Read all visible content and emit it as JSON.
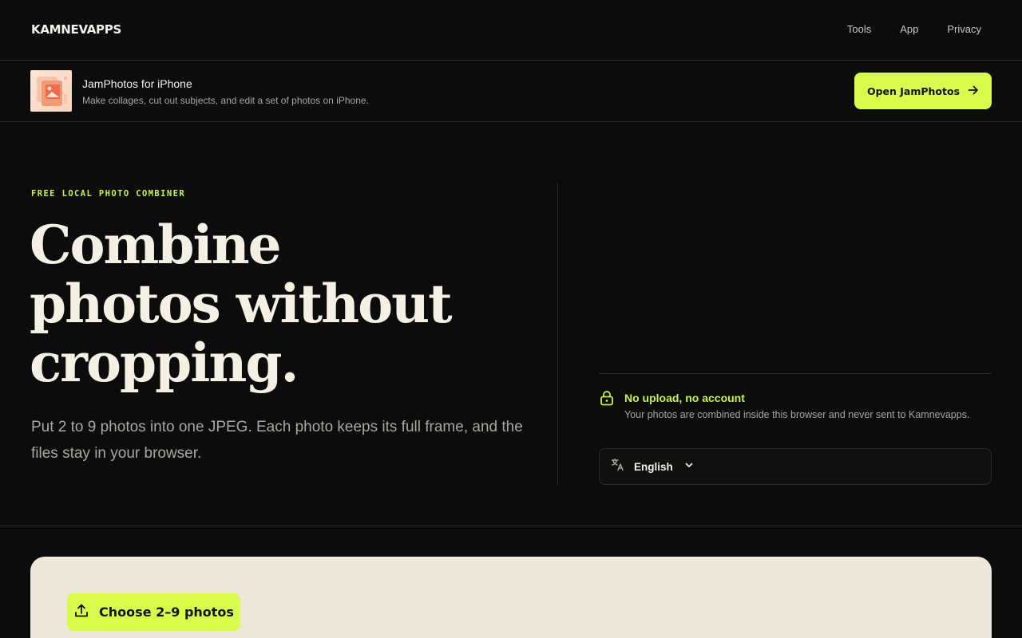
{
  "nav": {
    "brand": "KAMNEVAPPS",
    "links": [
      "Tools",
      "App",
      "Privacy"
    ]
  },
  "appbanner": {
    "title": "JamPhotos for iPhone",
    "description": "Make collages, cut out subjects, and edit a set of photos on iPhone.",
    "button_label": "Open JamPhotos",
    "icon": "arrow-right-icon"
  },
  "hero": {
    "eyebrow": "FREE LOCAL PHOTO COMBINER",
    "headline": [
      "Combine",
      "photos without",
      "cropping."
    ],
    "subtext": "Put 2 to 9 photos into one JPEG. Each photo keeps its full frame, and the files stay in your browser."
  },
  "privacy": {
    "title": "No upload, no account",
    "description": "Your photos are combined inside this browser and never sent to Kamnevapps.",
    "icon": "lock-icon"
  },
  "language": {
    "selected": "English",
    "icon": "translate-icon"
  },
  "upload": {
    "button_label": "Choose 2–9 photos",
    "icon": "upload-icon"
  },
  "colors": {
    "accent": "#d8fb4c",
    "accent_text": "#c9f24a",
    "background": "#0b0c0b",
    "panel": "#efe8da"
  }
}
